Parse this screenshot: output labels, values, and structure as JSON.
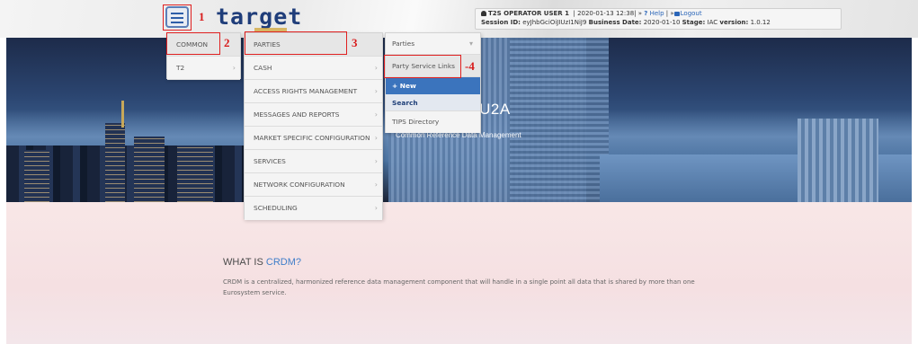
{
  "header": {
    "logo": "target",
    "user": {
      "line1": {
        "user": "T2S OPERATOR USER 1",
        "separator1": "|",
        "datetime": "2020-01-13 12:38",
        "separator2": "| »",
        "help_label": "Help",
        "separator3": "| »",
        "logout_label": "Logout"
      },
      "line2": {
        "session_label": "Session ID:",
        "session_value": "eyJhbGciOiJIUzI1NiJ9",
        "business_date_label": "Business Date:",
        "business_date_value": "2020-01-10",
        "stage_label": "Stage:",
        "stage_value": "IAC",
        "version_label": "version:",
        "version_value": "1.0.12"
      }
    }
  },
  "hero": {
    "title": "CRDM-U2A",
    "subtitle": "Common Reference Data Management"
  },
  "main": {
    "what_title": "WHAT IS ",
    "what_accent": "CRDM?",
    "what_body": "CRDM is a centralized, harmonized reference data management component that will handle in a single point all data that is shared by more than one Eurosystem service."
  },
  "menu_level1": {
    "items": [
      {
        "label": "COMMON"
      },
      {
        "label": "T2"
      }
    ]
  },
  "menu_level2": {
    "items": [
      {
        "label": "PARTIES"
      },
      {
        "label": "CASH"
      },
      {
        "label": "ACCESS RIGHTS MANAGEMENT"
      },
      {
        "label": "MESSAGES AND REPORTS"
      },
      {
        "label": "MARKET SPECIFIC CONFIGURATION"
      },
      {
        "label": "SERVICES"
      },
      {
        "label": "NETWORK CONFIGURATION"
      },
      {
        "label": "SCHEDULING"
      }
    ]
  },
  "menu_level3": {
    "items": [
      {
        "label": "Parties"
      },
      {
        "label": "Party Service Links"
      },
      {
        "label": "+ New"
      },
      {
        "label": "Search"
      },
      {
        "label": "TIPS Directory"
      }
    ]
  },
  "annotations": {
    "n1": "1",
    "n2": "2",
    "n3": "3",
    "n4": "-4"
  },
  "colors": {
    "annotation": "#e02020",
    "brand": "#1f3d7a",
    "accent": "#3f7ec9"
  }
}
